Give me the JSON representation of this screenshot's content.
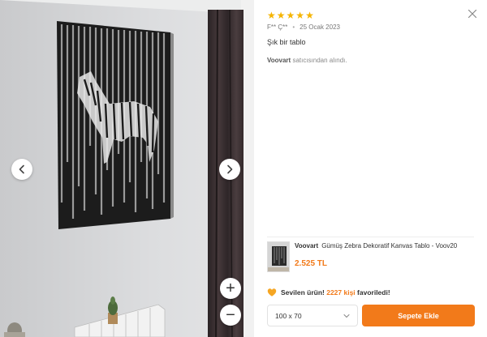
{
  "viewer": {
    "prev_icon": "chevron-left-icon",
    "next_icon": "chevron-right-icon",
    "zoom_in_label": "+",
    "zoom_out_label": "−"
  },
  "review": {
    "rating": 5,
    "star_glyph": "★",
    "author": "F** Ç**",
    "date": "25 Ocak 2023",
    "text": "Şık bir tablo",
    "seller_name": "Voovart",
    "seller_suffix": "satıcısından alındı."
  },
  "product": {
    "brand": "Voovart",
    "title": "Gümüş Zebra Dekoratif Kanvas Tablo - Voov20",
    "price": "2.525 TL"
  },
  "favorite": {
    "prefix": "Sevilen ürün!",
    "count": "2227 kişi",
    "suffix": "favoriledi!"
  },
  "actions": {
    "size_value": "100 x 70",
    "add_to_cart": "Sepete Ekle"
  },
  "colors": {
    "accent": "#f27a1a",
    "star": "#f5b400"
  }
}
